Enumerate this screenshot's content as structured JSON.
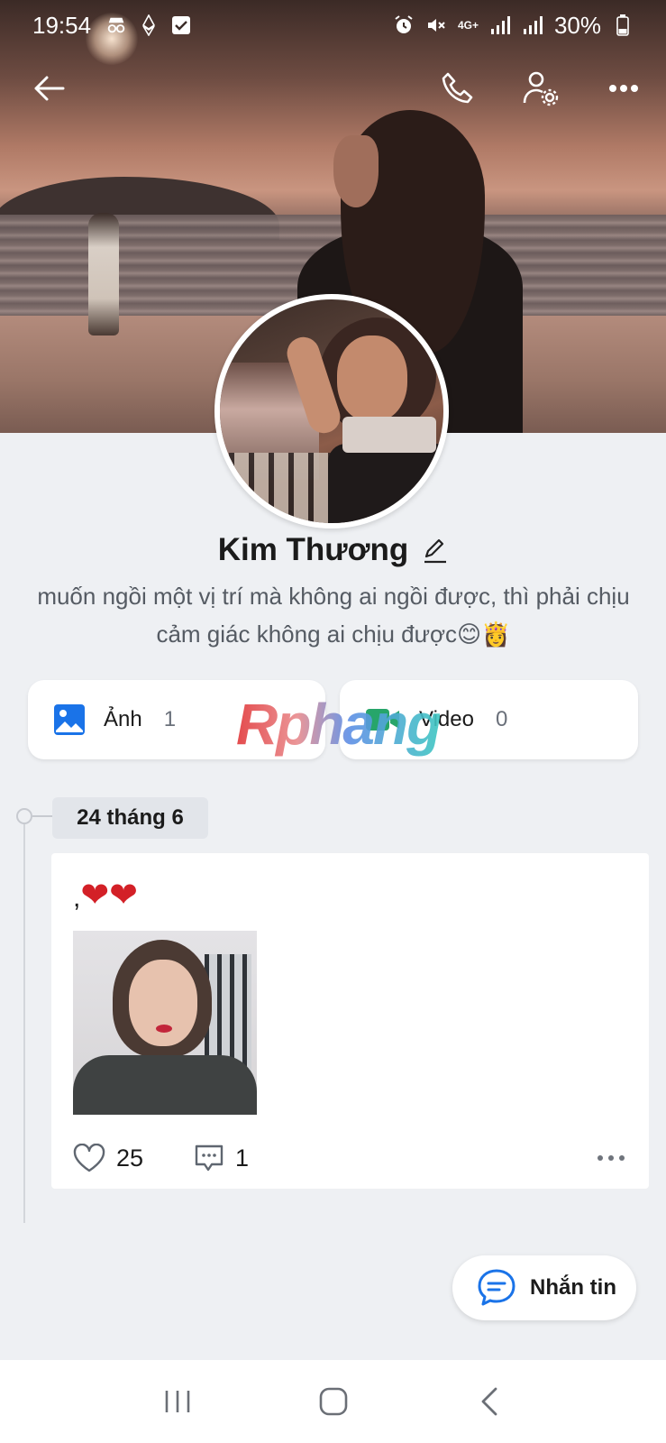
{
  "status_bar": {
    "time": "19:54",
    "network": "4G+",
    "battery": "30%"
  },
  "profile": {
    "name": "Kim Thương",
    "bio": "muốn ngồi một vị trí mà không ai ngồi được, thì phải chịu cảm giác không ai chịu được😊👸"
  },
  "media_tabs": {
    "photos_label": "Ảnh",
    "photos_count": "1",
    "videos_label": "Video",
    "videos_count": "0"
  },
  "watermark": "Rphang",
  "timeline": {
    "date": "24 tháng 6",
    "post": {
      "comma": ",",
      "hearts": "❤❤",
      "likes": "25",
      "comments": "1"
    }
  },
  "message_button": {
    "label": "Nhắn tin"
  },
  "colors": {
    "accent": "#1a73e8",
    "background": "#eef0f3",
    "card": "#ffffff"
  },
  "icons": {
    "top_bar": [
      "back-arrow-icon",
      "phone-icon",
      "user-settings-icon",
      "more-icon"
    ],
    "media": [
      "image-icon",
      "video-icon"
    ],
    "post_actions": [
      "heart-icon",
      "comment-icon",
      "more-dots-icon"
    ],
    "nav": [
      "recents-icon",
      "home-icon",
      "back-icon"
    ]
  }
}
